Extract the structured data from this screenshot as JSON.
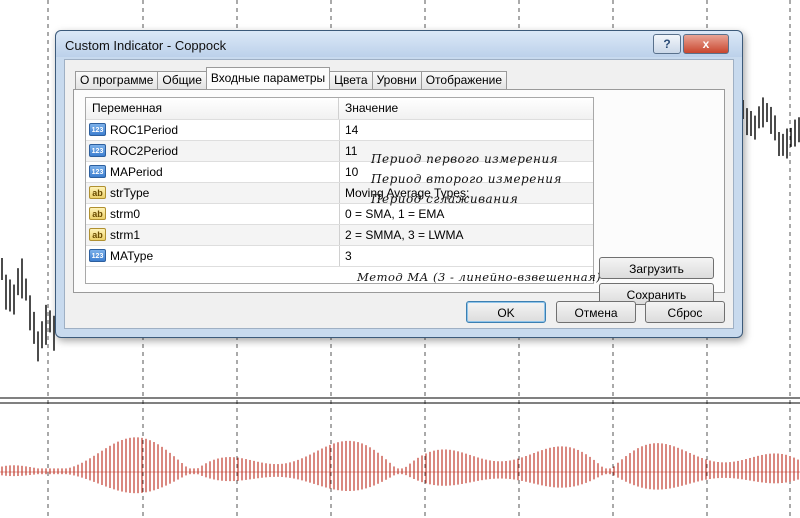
{
  "window": {
    "title": "Custom Indicator - Coppock"
  },
  "titlebar_buttons": {
    "help": "?",
    "close": "x"
  },
  "tabs": [
    {
      "label": "О программе",
      "active": false
    },
    {
      "label": "Общие",
      "active": false
    },
    {
      "label": "Входные параметры",
      "active": true
    },
    {
      "label": "Цвета",
      "active": false
    },
    {
      "label": "Уровни",
      "active": false
    },
    {
      "label": "Отображение",
      "active": false
    }
  ],
  "table": {
    "columns": [
      "Переменная",
      "Значение"
    ],
    "rows": [
      {
        "icon": "integer-icon",
        "icon_text": "123",
        "variable": "ROC1Period",
        "value": "14",
        "note": "Период первого измерения"
      },
      {
        "icon": "integer-icon",
        "icon_text": "123",
        "variable": "ROC2Period",
        "value": "11",
        "note": "Период второго измерения"
      },
      {
        "icon": "integer-icon",
        "icon_text": "123",
        "variable": "MAPeriod",
        "value": "10",
        "note": "Период сглаживания"
      },
      {
        "icon": "string-icon",
        "icon_text": "ab",
        "variable": "strType",
        "value": "Moving Average Types:",
        "note": ""
      },
      {
        "icon": "string-icon",
        "icon_text": "ab",
        "variable": "strm0",
        "value": "0 = SMA,  1 = EMA",
        "note": ""
      },
      {
        "icon": "string-icon",
        "icon_text": "ab",
        "variable": "strm1",
        "value": "2 = SMMA, 3 = LWMA",
        "note": ""
      },
      {
        "icon": "integer-icon",
        "icon_text": "123",
        "variable": "MAType",
        "value": "3",
        "note": "Метод МА (3 - линейно-взвешенная)"
      }
    ]
  },
  "side_buttons": {
    "load": "Загрузить",
    "save": "Сохранить"
  },
  "footer_buttons": {
    "ok": "OK",
    "cancel": "Отмена",
    "reset": "Сброс"
  },
  "colors": {
    "histogram": "#c0392b",
    "candles": "#000000",
    "grid": "#555555",
    "title_bg": "#c8daee"
  }
}
